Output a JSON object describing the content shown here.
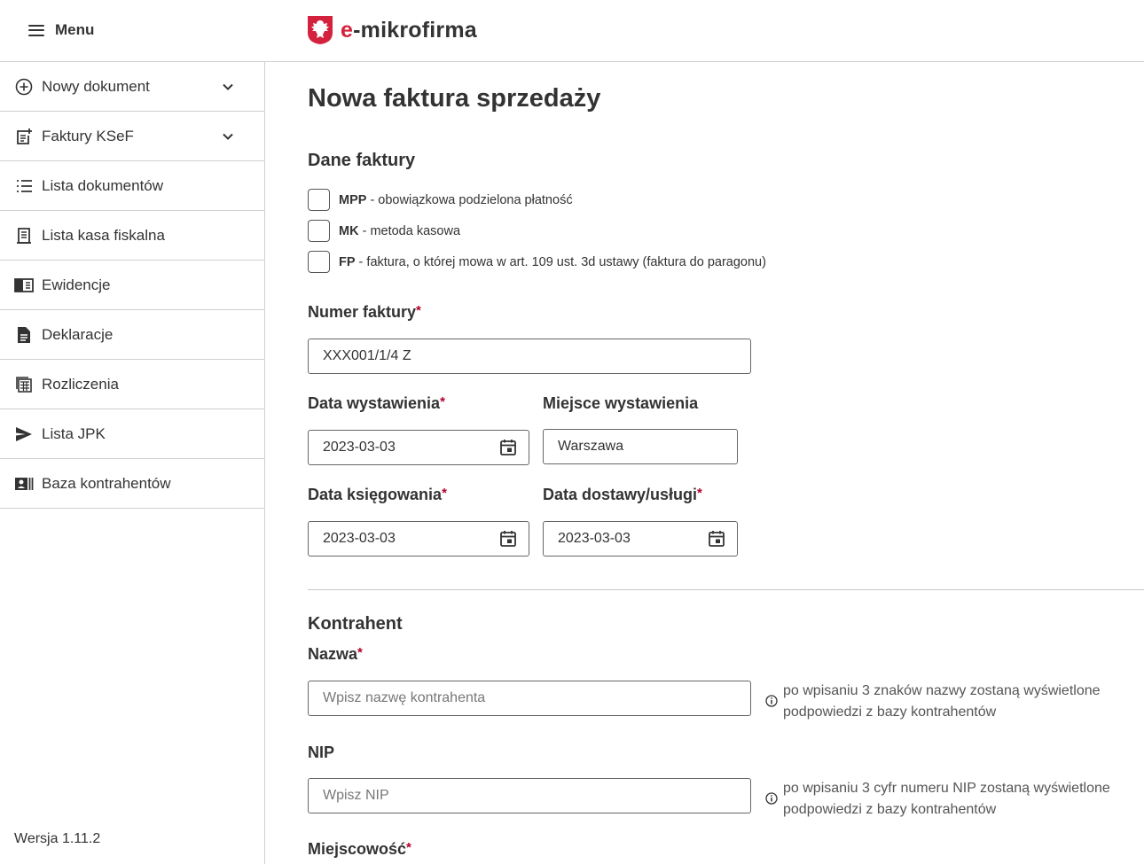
{
  "header": {
    "menu_label": "Menu",
    "brand_prefix": "e",
    "brand_rest": "-mikrofirma"
  },
  "sidebar": {
    "items": [
      {
        "label": "Nowy dokument",
        "icon": "plus-circle-icon",
        "has_chevron": true
      },
      {
        "label": "Faktury KSeF",
        "icon": "document-add-icon",
        "has_chevron": true
      },
      {
        "label": "Lista dokumentów",
        "icon": "list-icon",
        "has_chevron": false
      },
      {
        "label": "Lista kasa fiskalna",
        "icon": "receipt-icon",
        "has_chevron": false
      },
      {
        "label": "Ewidencje",
        "icon": "ledger-icon",
        "has_chevron": false
      },
      {
        "label": "Deklaracje",
        "icon": "file-icon",
        "has_chevron": false
      },
      {
        "label": "Rozliczenia",
        "icon": "calculator-icon",
        "has_chevron": false
      },
      {
        "label": "Lista JPK",
        "icon": "send-icon",
        "has_chevron": false
      },
      {
        "label": "Baza kontrahentów",
        "icon": "contacts-icon",
        "has_chevron": false
      }
    ],
    "version": "Wersja 1.11.2"
  },
  "main": {
    "title": "Nowa faktura sprzedaży",
    "invoice_section": "Dane faktury",
    "checkboxes": [
      {
        "code": "MPP",
        "text": " - obowiązkowa podzielona płatność",
        "checked": false
      },
      {
        "code": "MK",
        "text": " - metoda kasowa",
        "checked": false
      },
      {
        "code": "FP",
        "text": " - faktura, o której mowa w art. 109 ust. 3d ustawy (faktura do paragonu)",
        "checked": false
      }
    ],
    "invoice_number": {
      "label": "Numer faktury",
      "value": "XXX001/1/4 Z"
    },
    "issue_date": {
      "label": "Data wystawienia",
      "value": "2023-03-03"
    },
    "issue_place": {
      "label": "Miejsce wystawienia",
      "value": "Warszawa"
    },
    "posting_date": {
      "label": "Data księgowania",
      "value": "2023-03-03"
    },
    "delivery_date": {
      "label": "Data dostawy/usługi",
      "value": "2023-03-03"
    },
    "contractor_section": "Kontrahent",
    "name_field": {
      "label": "Nazwa",
      "placeholder": "Wpisz nazwę kontrahenta",
      "hint": "po wpisaniu 3 znaków nazwy zostaną wyświetlone podpowiedzi z bazy kontrahentów"
    },
    "nip_field": {
      "label": "NIP",
      "placeholder": "Wpisz NIP",
      "hint": "po wpisaniu 3 cyfr numeru NIP zostaną wyświetlone podpowiedzi z bazy kontrahentów"
    },
    "city_field": {
      "label": "Miejscowość"
    },
    "required_mark": "*"
  },
  "colors": {
    "brand_red": "#d4213d",
    "required_red": "#b3002d",
    "text": "#333333",
    "border": "#d0d0d0"
  }
}
